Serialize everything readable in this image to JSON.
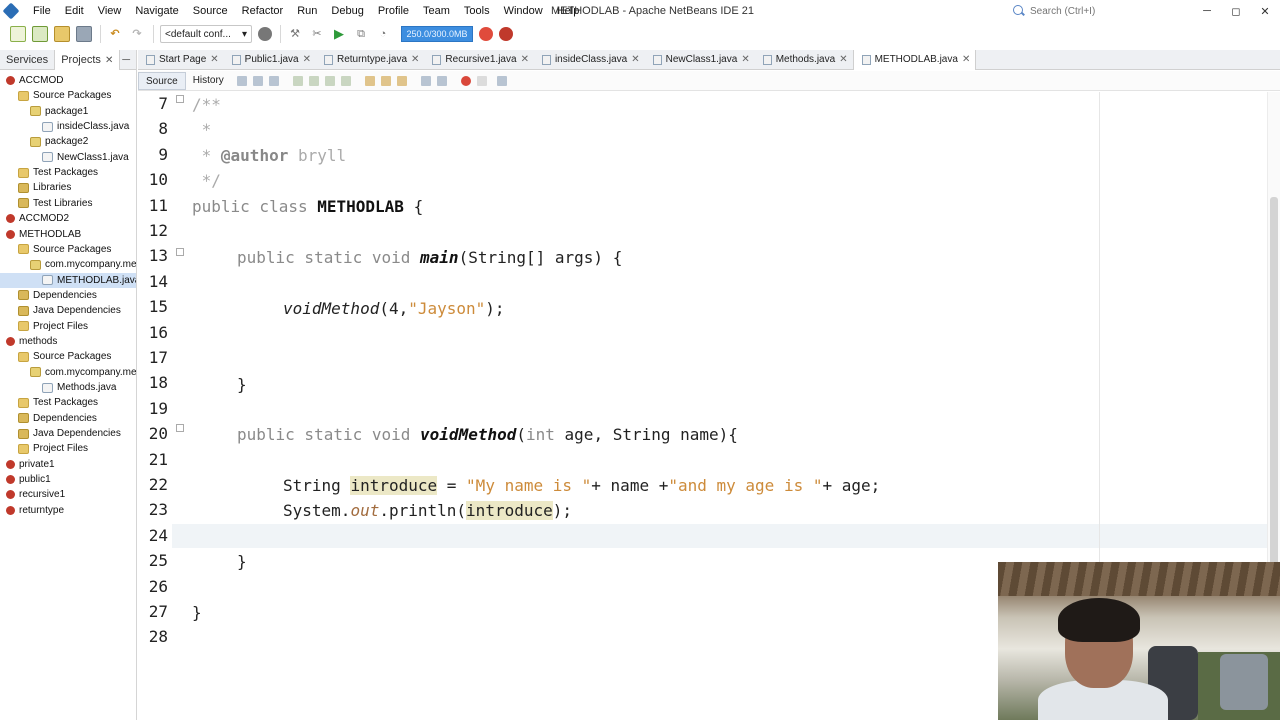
{
  "window": {
    "title": "METHODLAB - Apache NetBeans IDE 21",
    "search_placeholder": "Search (Ctrl+I)",
    "controls": [
      "─",
      "◻",
      "✕"
    ]
  },
  "menu": [
    "File",
    "Edit",
    "View",
    "Navigate",
    "Source",
    "Refactor",
    "Run",
    "Debug",
    "Profile",
    "Team",
    "Tools",
    "Window",
    "Help"
  ],
  "toolbar": {
    "config": "<default conf...",
    "memory": "250.0/300.0MB"
  },
  "left_panel": {
    "tabs": [
      {
        "label": "Services",
        "active": false
      },
      {
        "label": "Projects",
        "active": true,
        "close": "✕"
      }
    ],
    "minimize": "─",
    "tree": [
      {
        "label": "ACCMOD",
        "level": 0,
        "icon": "project"
      },
      {
        "label": "Source Packages",
        "level": 1,
        "icon": "folder"
      },
      {
        "label": "package1",
        "level": 2,
        "icon": "package"
      },
      {
        "label": "insideClass.java",
        "level": 3,
        "icon": "java"
      },
      {
        "label": "package2",
        "level": 2,
        "icon": "package"
      },
      {
        "label": "NewClass1.java",
        "level": 3,
        "icon": "java"
      },
      {
        "label": "Test Packages",
        "level": 1,
        "icon": "folder"
      },
      {
        "label": "Libraries",
        "level": 1,
        "icon": "lib"
      },
      {
        "label": "Test Libraries",
        "level": 1,
        "icon": "lib"
      },
      {
        "label": "ACCMOD2",
        "level": 0,
        "icon": "project"
      },
      {
        "label": "METHODLAB",
        "level": 0,
        "icon": "project"
      },
      {
        "label": "Source Packages",
        "level": 1,
        "icon": "folder"
      },
      {
        "label": "com.mycompany.met",
        "level": 2,
        "icon": "package"
      },
      {
        "label": "METHODLAB.java",
        "level": 3,
        "icon": "java",
        "selected": true
      },
      {
        "label": "Dependencies",
        "level": 1,
        "icon": "lib"
      },
      {
        "label": "Java Dependencies",
        "level": 1,
        "icon": "lib"
      },
      {
        "label": "Project Files",
        "level": 1,
        "icon": "folder"
      },
      {
        "label": "methods",
        "level": 0,
        "icon": "project"
      },
      {
        "label": "Source Packages",
        "level": 1,
        "icon": "folder"
      },
      {
        "label": "com.mycompany.met",
        "level": 2,
        "icon": "package"
      },
      {
        "label": "Methods.java",
        "level": 3,
        "icon": "java"
      },
      {
        "label": "Test Packages",
        "level": 1,
        "icon": "folder"
      },
      {
        "label": "Dependencies",
        "level": 1,
        "icon": "lib"
      },
      {
        "label": "Java Dependencies",
        "level": 1,
        "icon": "lib"
      },
      {
        "label": "Project Files",
        "level": 1,
        "icon": "folder"
      },
      {
        "label": "private1",
        "level": 0,
        "icon": "project"
      },
      {
        "label": "public1",
        "level": 0,
        "icon": "project"
      },
      {
        "label": "recursive1",
        "level": 0,
        "icon": "project"
      },
      {
        "label": "returntype",
        "level": 0,
        "icon": "project"
      }
    ]
  },
  "editor": {
    "tabs": [
      {
        "label": "Start Page",
        "active": false
      },
      {
        "label": "Public1.java",
        "active": false
      },
      {
        "label": "Returntype.java",
        "active": false
      },
      {
        "label": "Recursive1.java",
        "active": false
      },
      {
        "label": "insideClass.java",
        "active": false
      },
      {
        "label": "NewClass1.java",
        "active": false
      },
      {
        "label": "Methods.java",
        "active": false
      },
      {
        "label": "METHODLAB.java",
        "active": true
      }
    ],
    "close_glyph": "✕",
    "modes": [
      {
        "label": "Source",
        "active": true
      },
      {
        "label": "History",
        "active": false
      }
    ],
    "line_numbers": [
      "7",
      "8",
      "9",
      "10",
      "11",
      "12",
      "13",
      "14",
      "15",
      "16",
      "17",
      "18",
      "19",
      "20",
      "21",
      "22",
      "23",
      "24",
      "25",
      "26",
      "27",
      "28"
    ],
    "code": {
      "l7": "/**",
      "l8": " *",
      "l9_star": " * ",
      "l9_tag": "@author",
      "l9_rest": " bryll",
      "l10": " */",
      "l11_kw": "public class ",
      "l11_name": "METHODLAB",
      "l11_end": " {",
      "l13_kw": "public static void ",
      "l13_name": "main",
      "l13_end": "(String[] args) {",
      "l15_name": "voidMethod",
      "l15_open": "(4,",
      "l15_str": "\"Jayson\"",
      "l15_end": ");",
      "l18": "}",
      "l20_kw": "public static void ",
      "l20_name": "voidMethod",
      "l20_open": "(",
      "l20_kw2": "int",
      "l20_end": " age, String name){",
      "l22_a": "String ",
      "l22_var": "introduce",
      "l22_eq": " = ",
      "l22_s1": "\"My name is \"",
      "l22_mid": "+ name +",
      "l22_s2": "\"and my age is \"",
      "l22_end": "+ age;",
      "l23_a": "System.",
      "l23_out": "out",
      "l23_b": ".println(",
      "l23_var": "introduce",
      "l23_end": ");",
      "l25": "}",
      "l27": "}"
    }
  }
}
